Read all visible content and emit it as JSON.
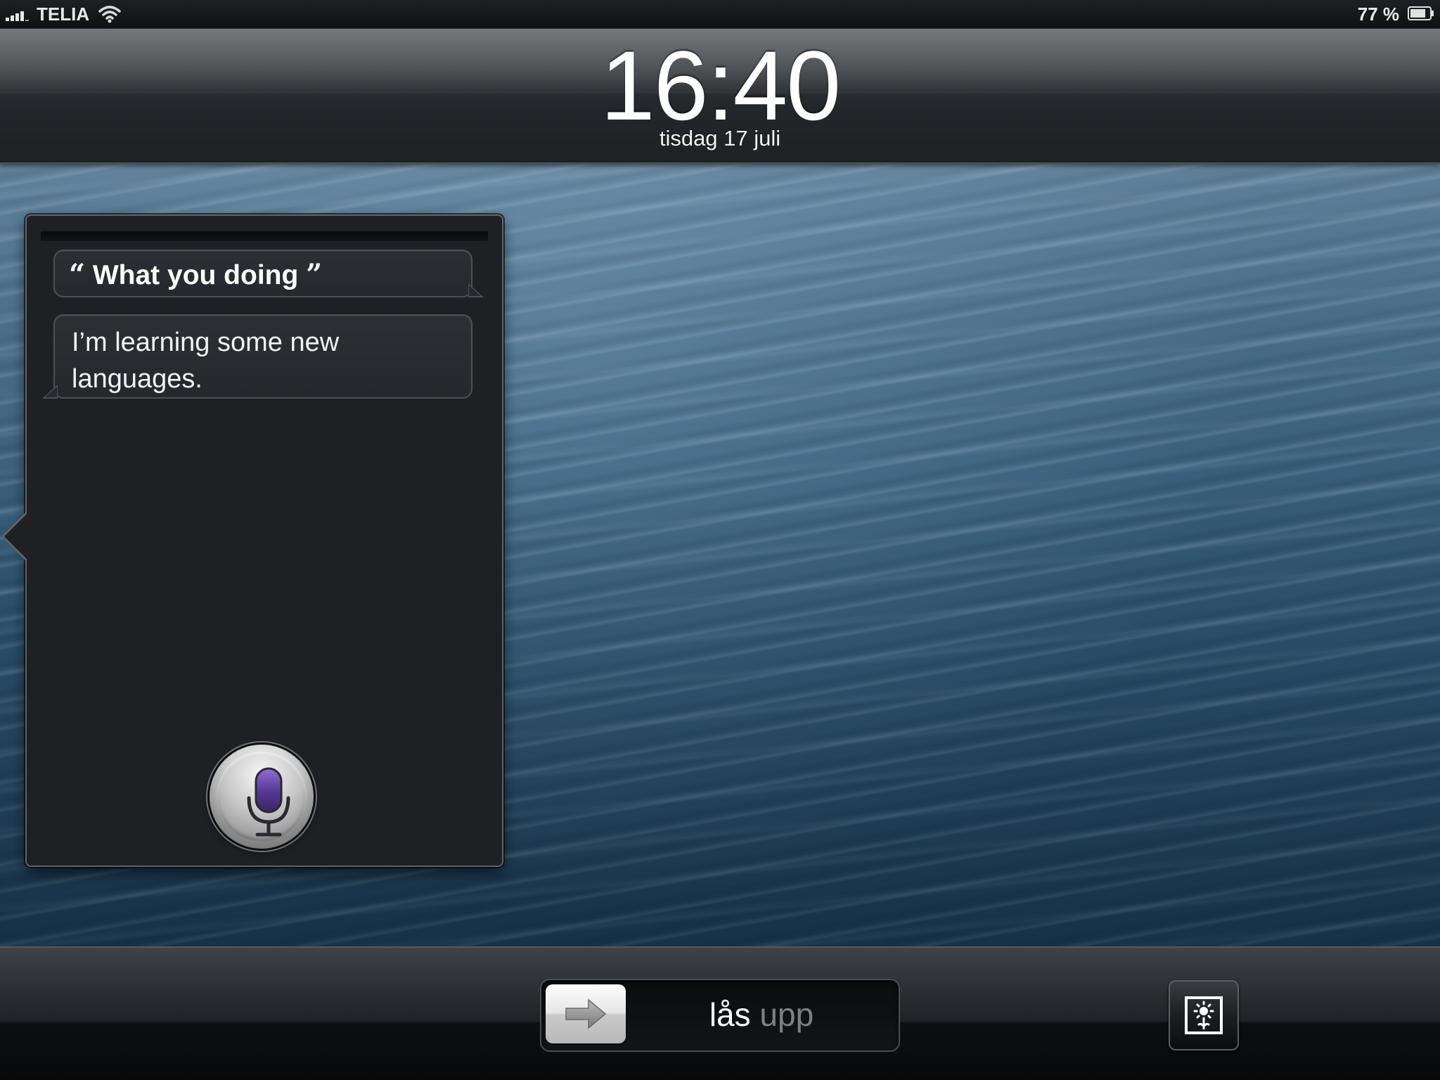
{
  "status_bar": {
    "carrier": "TELIA",
    "battery_percent": "77 %",
    "signal_icon": "signal-bars-icon",
    "wifi_icon": "wifi-icon",
    "battery_icon": "battery-icon"
  },
  "lock_screen": {
    "time": "16:40",
    "date": "tisdag 17 juli"
  },
  "siri": {
    "user_query": "What you doing",
    "open_quote": "“",
    "close_quote": "”",
    "reply": "I’m learning some new languages.",
    "mic_icon": "microphone-icon",
    "mic_color": "#4a2f7a"
  },
  "unlock_slider": {
    "label_bright": "lås",
    "label_dim": "upp",
    "knob_icon": "arrow-right-icon"
  },
  "camera": {
    "icon": "photo-frame-icon"
  },
  "colors": {
    "wallpaper_blue": "#2e5571",
    "panel_bg": "#1e2023",
    "bubble_border": "#4c5056"
  }
}
